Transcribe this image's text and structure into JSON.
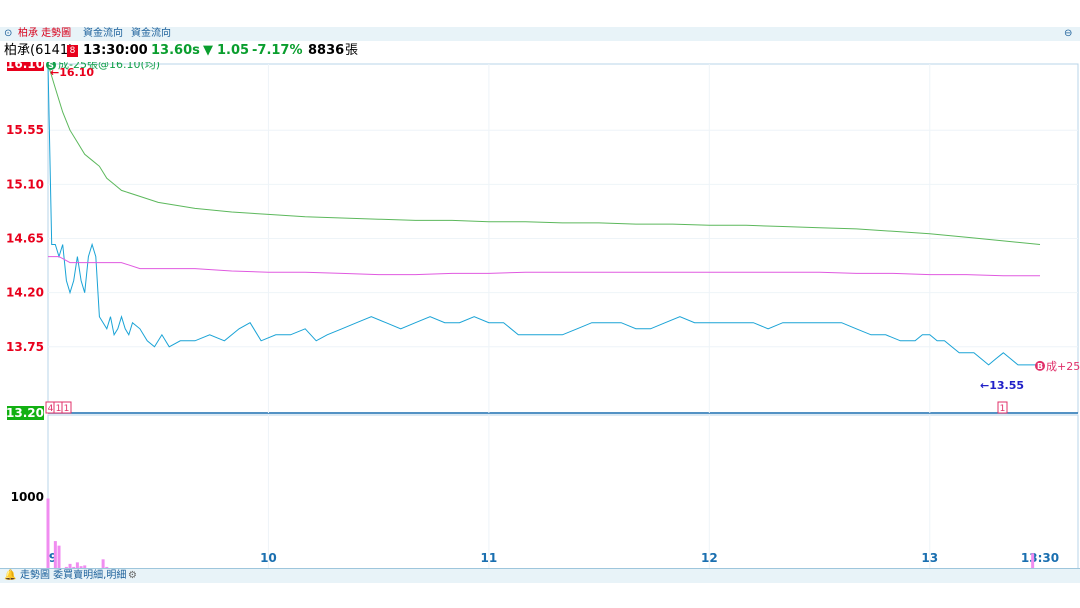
{
  "tabs": [
    {
      "label": "柏承 走勢圖",
      "active": true
    },
    {
      "label": "資金流向",
      "active": false
    },
    {
      "label": "資金流向",
      "active": false
    }
  ],
  "quote": {
    "name": "柏承(6141)",
    "badge": "8",
    "time": "13:30:00",
    "price": "13.60s",
    "change_arrow": "▼",
    "change": "1.05",
    "change_pct": "-7.17%",
    "volume": "8836",
    "volume_unit": "張"
  },
  "colors": {
    "price": "#1aa3d6",
    "average": "#e05ae0",
    "reference": "#5cb85c",
    "volume": "#f08cf0",
    "up": "#e8001c",
    "down": "#0a9e2e",
    "axis": "#1a6fb0"
  },
  "annotations": {
    "sell_label": "成-25張@16.10(均)",
    "sell_icon": "S",
    "high_label": "←16.10",
    "low_label": "←13.55",
    "buy_label": "成+25",
    "buy_icon": "B",
    "markers": [
      "4",
      "1",
      "1",
      "1"
    ]
  },
  "bottom_tabs": {
    "label": "走勢圖 委買賣明細,明細",
    "bell_icon": "bell-icon",
    "settings_icon": "gear-icon"
  },
  "chart_data": {
    "type": "line",
    "price_axis": {
      "ticks": [
        "16.10",
        "15.55",
        "15.10",
        "14.65",
        "14.20",
        "13.75",
        "13.20"
      ],
      "ylim": [
        13.2,
        16.1
      ]
    },
    "volume_axis": {
      "ticks": [
        "1000",
        "0"
      ],
      "ylim": [
        0,
        1000
      ]
    },
    "x_ticks": [
      "9",
      "10",
      "11",
      "12",
      "13",
      "13:30"
    ],
    "xlim_minutes": [
      0,
      270
    ],
    "series": [
      {
        "key": "price",
        "points": [
          [
            0,
            16.1
          ],
          [
            1,
            14.6
          ],
          [
            2,
            14.6
          ],
          [
            3,
            14.5
          ],
          [
            4,
            14.6
          ],
          [
            5,
            14.3
          ],
          [
            6,
            14.2
          ],
          [
            7,
            14.3
          ],
          [
            8,
            14.5
          ],
          [
            9,
            14.3
          ],
          [
            10,
            14.2
          ],
          [
            11,
            14.5
          ],
          [
            12,
            14.6
          ],
          [
            13,
            14.5
          ],
          [
            14,
            14.0
          ],
          [
            15,
            13.95
          ],
          [
            16,
            13.9
          ],
          [
            17,
            14.0
          ],
          [
            18,
            13.85
          ],
          [
            19,
            13.9
          ],
          [
            20,
            14.0
          ],
          [
            21,
            13.9
          ],
          [
            22,
            13.85
          ],
          [
            23,
            13.95
          ],
          [
            25,
            13.9
          ],
          [
            27,
            13.8
          ],
          [
            29,
            13.75
          ],
          [
            31,
            13.85
          ],
          [
            33,
            13.75
          ],
          [
            36,
            13.8
          ],
          [
            40,
            13.8
          ],
          [
            44,
            13.85
          ],
          [
            48,
            13.8
          ],
          [
            52,
            13.9
          ],
          [
            55,
            13.95
          ],
          [
            58,
            13.8
          ],
          [
            62,
            13.85
          ],
          [
            66,
            13.85
          ],
          [
            70,
            13.9
          ],
          [
            73,
            13.8
          ],
          [
            76,
            13.85
          ],
          [
            80,
            13.9
          ],
          [
            84,
            13.95
          ],
          [
            88,
            14.0
          ],
          [
            92,
            13.95
          ],
          [
            96,
            13.9
          ],
          [
            100,
            13.95
          ],
          [
            104,
            14.0
          ],
          [
            108,
            13.95
          ],
          [
            112,
            13.95
          ],
          [
            116,
            14.0
          ],
          [
            120,
            13.95
          ],
          [
            124,
            13.95
          ],
          [
            128,
            13.85
          ],
          [
            132,
            13.85
          ],
          [
            136,
            13.85
          ],
          [
            140,
            13.85
          ],
          [
            144,
            13.9
          ],
          [
            148,
            13.95
          ],
          [
            152,
            13.95
          ],
          [
            156,
            13.95
          ],
          [
            160,
            13.9
          ],
          [
            164,
            13.9
          ],
          [
            168,
            13.95
          ],
          [
            172,
            14.0
          ],
          [
            176,
            13.95
          ],
          [
            180,
            13.95
          ],
          [
            184,
            13.95
          ],
          [
            188,
            13.95
          ],
          [
            192,
            13.95
          ],
          [
            196,
            13.9
          ],
          [
            200,
            13.95
          ],
          [
            204,
            13.95
          ],
          [
            208,
            13.95
          ],
          [
            212,
            13.95
          ],
          [
            216,
            13.95
          ],
          [
            220,
            13.9
          ],
          [
            224,
            13.85
          ],
          [
            228,
            13.85
          ],
          [
            232,
            13.8
          ],
          [
            236,
            13.8
          ],
          [
            238,
            13.85
          ],
          [
            240,
            13.85
          ],
          [
            242,
            13.8
          ],
          [
            244,
            13.8
          ],
          [
            246,
            13.75
          ],
          [
            248,
            13.7
          ],
          [
            250,
            13.7
          ],
          [
            252,
            13.7
          ],
          [
            254,
            13.65
          ],
          [
            256,
            13.6
          ],
          [
            258,
            13.65
          ],
          [
            260,
            13.7
          ],
          [
            262,
            13.65
          ],
          [
            264,
            13.6
          ],
          [
            266,
            13.6
          ],
          [
            268,
            13.6
          ],
          [
            270,
            13.6
          ]
        ]
      },
      {
        "key": "average",
        "points": [
          [
            0,
            14.5
          ],
          [
            3,
            14.5
          ],
          [
            6,
            14.45
          ],
          [
            10,
            14.45
          ],
          [
            15,
            14.45
          ],
          [
            20,
            14.45
          ],
          [
            25,
            14.4
          ],
          [
            30,
            14.4
          ],
          [
            40,
            14.4
          ],
          [
            50,
            14.38
          ],
          [
            60,
            14.37
          ],
          [
            70,
            14.37
          ],
          [
            80,
            14.36
          ],
          [
            90,
            14.35
          ],
          [
            100,
            14.35
          ],
          [
            110,
            14.36
          ],
          [
            120,
            14.36
          ],
          [
            130,
            14.37
          ],
          [
            140,
            14.37
          ],
          [
            150,
            14.37
          ],
          [
            160,
            14.37
          ],
          [
            170,
            14.37
          ],
          [
            180,
            14.37
          ],
          [
            190,
            14.37
          ],
          [
            200,
            14.37
          ],
          [
            210,
            14.37
          ],
          [
            220,
            14.36
          ],
          [
            230,
            14.36
          ],
          [
            240,
            14.35
          ],
          [
            250,
            14.35
          ],
          [
            260,
            14.34
          ],
          [
            270,
            14.34
          ]
        ]
      },
      {
        "key": "reference",
        "points": [
          [
            0,
            16.1
          ],
          [
            2,
            15.9
          ],
          [
            4,
            15.7
          ],
          [
            6,
            15.55
          ],
          [
            8,
            15.45
          ],
          [
            10,
            15.35
          ],
          [
            12,
            15.3
          ],
          [
            14,
            15.25
          ],
          [
            16,
            15.15
          ],
          [
            18,
            15.1
          ],
          [
            20,
            15.05
          ],
          [
            25,
            15.0
          ],
          [
            30,
            14.95
          ],
          [
            40,
            14.9
          ],
          [
            50,
            14.87
          ],
          [
            60,
            14.85
          ],
          [
            70,
            14.83
          ],
          [
            80,
            14.82
          ],
          [
            90,
            14.81
          ],
          [
            100,
            14.8
          ],
          [
            110,
            14.8
          ],
          [
            120,
            14.79
          ],
          [
            130,
            14.79
          ],
          [
            140,
            14.78
          ],
          [
            150,
            14.78
          ],
          [
            160,
            14.77
          ],
          [
            170,
            14.77
          ],
          [
            180,
            14.76
          ],
          [
            190,
            14.76
          ],
          [
            200,
            14.75
          ],
          [
            210,
            14.74
          ],
          [
            220,
            14.73
          ],
          [
            230,
            14.71
          ],
          [
            240,
            14.69
          ],
          [
            250,
            14.66
          ],
          [
            260,
            14.63
          ],
          [
            270,
            14.6
          ]
        ]
      }
    ],
    "volume": [
      [
        0,
        980
      ],
      [
        2,
        420
      ],
      [
        3,
        360
      ],
      [
        5,
        80
      ],
      [
        6,
        120
      ],
      [
        7,
        80
      ],
      [
        8,
        140
      ],
      [
        9,
        90
      ],
      [
        10,
        100
      ],
      [
        11,
        60
      ],
      [
        12,
        45
      ],
      [
        13,
        40
      ],
      [
        14,
        30
      ],
      [
        15,
        180
      ],
      [
        16,
        80
      ],
      [
        17,
        60
      ],
      [
        18,
        50
      ],
      [
        20,
        30
      ],
      [
        22,
        20
      ],
      [
        25,
        20
      ],
      [
        28,
        15
      ],
      [
        30,
        10
      ],
      [
        35,
        20
      ],
      [
        40,
        10
      ],
      [
        45,
        10
      ],
      [
        50,
        15
      ],
      [
        55,
        5
      ],
      [
        60,
        5
      ],
      [
        70,
        10
      ],
      [
        80,
        5
      ],
      [
        100,
        5
      ],
      [
        110,
        5
      ],
      [
        120,
        5
      ],
      [
        130,
        5
      ],
      [
        140,
        5
      ],
      [
        150,
        5
      ],
      [
        160,
        10
      ],
      [
        170,
        5
      ],
      [
        180,
        5
      ],
      [
        190,
        10
      ],
      [
        200,
        5
      ],
      [
        210,
        5
      ],
      [
        220,
        5
      ],
      [
        225,
        10
      ],
      [
        230,
        15
      ],
      [
        240,
        5
      ],
      [
        245,
        10
      ],
      [
        250,
        10
      ],
      [
        255,
        15
      ],
      [
        258,
        20
      ],
      [
        261,
        10
      ],
      [
        264,
        25
      ],
      [
        268,
        260
      ]
    ]
  }
}
